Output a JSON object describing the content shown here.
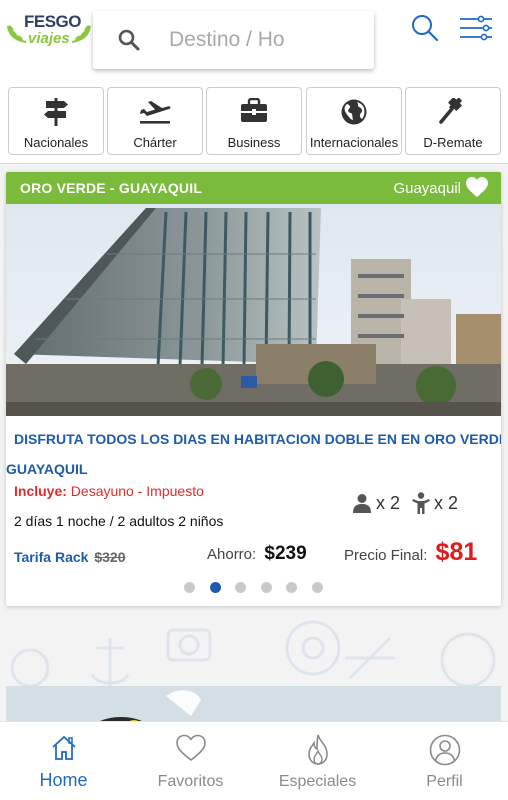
{
  "header": {
    "logo_top": "FESGO",
    "logo_bottom": "viajes",
    "search_placeholder": "Destino / Ho"
  },
  "categories": [
    {
      "label": "Nacionales",
      "icon": "signpost-icon"
    },
    {
      "label": "Chárter",
      "icon": "airplane-icon"
    },
    {
      "label": "Business",
      "icon": "briefcase-icon"
    },
    {
      "label": "Internacionales",
      "icon": "globe-icon"
    },
    {
      "label": "D-Remate",
      "icon": "gavel-icon"
    }
  ],
  "offer": {
    "title": "ORO VERDE - GUAYAQUIL",
    "city": "Guayaquil",
    "description_line1": "DISFRUTA TODOS LOS DIAS EN HABITACION DOBLE EN EN ORO VERDE",
    "description_line2": "GUAYAQUIL",
    "includes_label": "Incluye:",
    "includes_value": "Desayuno - Impuesto",
    "adults_count": "x 2",
    "children_count": "x 2",
    "stay": "2 días 1 noche / 2 adultos 2 niños",
    "rack_label": "Tarifa Rack",
    "rack_price": "$320",
    "savings_label": "Ahorro:",
    "savings_value": "$239",
    "final_label": "Precio Final:",
    "final_price": "$81",
    "carousel_pages": 6,
    "carousel_active": 2
  },
  "nav": {
    "home": "Home",
    "favorites": "Favoritos",
    "specials": "Especiales",
    "profile": "Perfil"
  },
  "colors": {
    "accent_blue": "#1e5bab",
    "header_green": "#7bbb3c",
    "price_red": "#e01b1b"
  }
}
